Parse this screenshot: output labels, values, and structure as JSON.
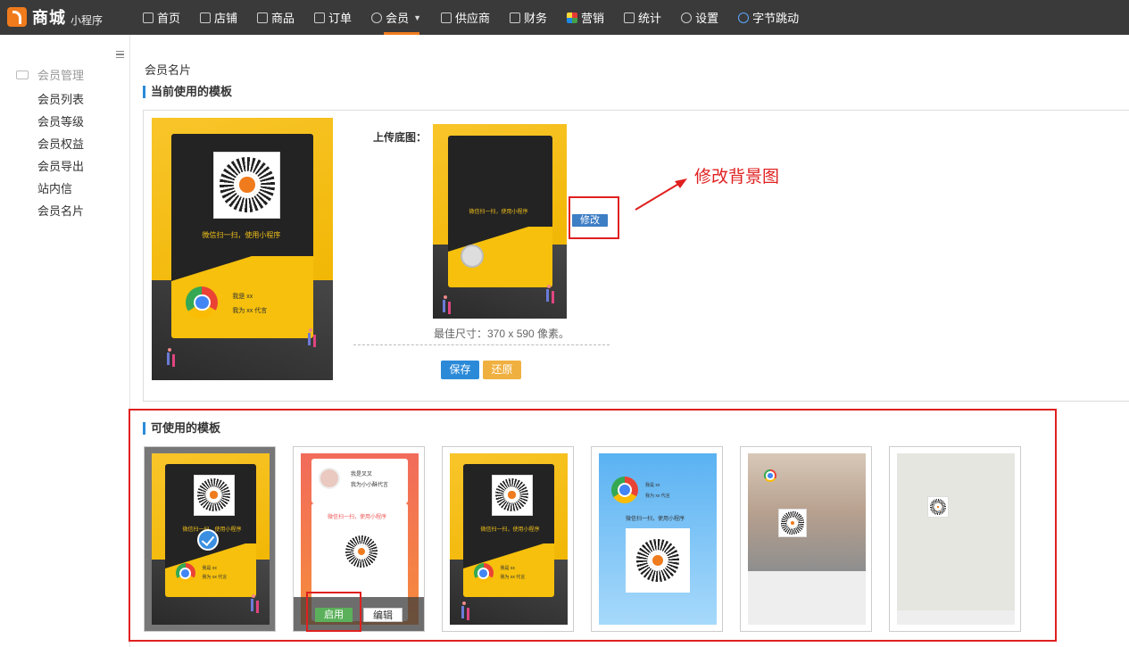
{
  "logo": {
    "brand": "商城",
    "sub": "小程序"
  },
  "nav": [
    {
      "label": "首页",
      "icon": "palette-icon"
    },
    {
      "label": "店铺",
      "icon": "home-icon"
    },
    {
      "label": "商品",
      "icon": "tag-icon"
    },
    {
      "label": "订单",
      "icon": "order-icon"
    },
    {
      "label": "会员",
      "icon": "user-icon",
      "active": true
    },
    {
      "label": "供应商",
      "icon": "box-icon"
    },
    {
      "label": "财务",
      "icon": "finance-icon"
    },
    {
      "label": "营销",
      "icon": "marketing-icon"
    },
    {
      "label": "统计",
      "icon": "chart-icon"
    },
    {
      "label": "设置",
      "icon": "gear-icon"
    },
    {
      "label": "字节跳动",
      "icon": "bytedance-icon"
    }
  ],
  "sidebar": {
    "heading": "会员管理",
    "items": [
      "会员列表",
      "会员等级",
      "会员权益",
      "会员导出",
      "站内信",
      "会员名片"
    ]
  },
  "page": {
    "breadcrumb": "会员名片",
    "current_title": "当前使用的模板",
    "available_title": "可使用的模板",
    "upload_label": "上传底图：",
    "size_hint": "最佳尺寸：370 x 590 像素。",
    "save": "保存",
    "reset": "还原",
    "modify": "修改",
    "annotation": "修改背景图",
    "enable": "启用",
    "edit": "编辑"
  },
  "poster": {
    "scan_text": "微信扫一扫，使用小程序",
    "name_text": "我是 xx",
    "agent_text": "我为 xx 代言"
  },
  "template2": {
    "name": "我是叉叉",
    "agent": "我为小小酥代言",
    "scan": "微信扫一扫，使用小程序"
  },
  "colors": {
    "accent": "#f07b1d",
    "primary": "#2b8ad8",
    "warning": "#f0b040",
    "annotation": "#e02020",
    "success": "#5bb15b"
  }
}
